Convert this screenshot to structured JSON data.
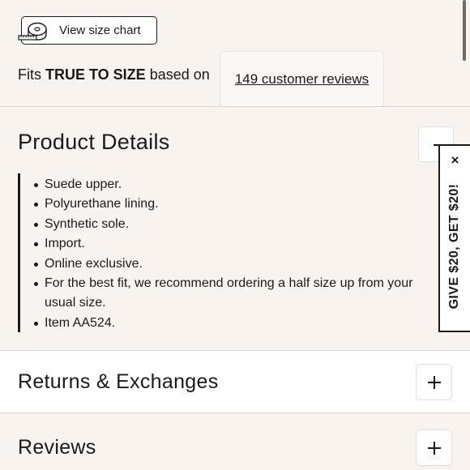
{
  "size_chart": {
    "label": "View size chart",
    "icon": "tape-measure-icon"
  },
  "fit": {
    "prefix": "Fits",
    "emphasis": "TRUE TO SIZE",
    "suffix": "based on",
    "reviews_link": "149 customer reviews"
  },
  "product_details": {
    "title": "Product Details",
    "toggle_icon": "minus-icon",
    "items": [
      "Suede upper.",
      "Polyurethane lining.",
      "Synthetic sole.",
      "Import.",
      "Online exclusive.",
      "For the best fit, we recommend ordering a half size up from your usual size.",
      "Item AA524."
    ]
  },
  "returns": {
    "title": "Returns & Exchanges",
    "toggle_icon": "plus-icon"
  },
  "reviews": {
    "title": "Reviews",
    "toggle_icon": "plus-icon"
  },
  "referral": {
    "label": "GIVE $20, GET $20!",
    "close": "×"
  },
  "colors": {
    "background": "#f8f3ef",
    "text": "#1a1a1a",
    "panel": "#ffffff"
  }
}
